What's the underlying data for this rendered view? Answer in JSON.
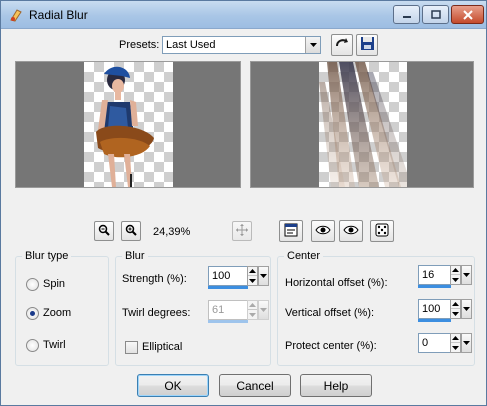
{
  "window": {
    "title": "Radial Blur"
  },
  "presets": {
    "label": "Presets:",
    "value": "Last Used"
  },
  "zoom": {
    "level": "24,39%"
  },
  "blur_type": {
    "title": "Blur type",
    "options": [
      {
        "label": "Spin",
        "selected": false
      },
      {
        "label": "Zoom",
        "selected": true
      },
      {
        "label": "Twirl",
        "selected": false
      }
    ]
  },
  "blur": {
    "title": "Blur",
    "strength_label": "Strength (%):",
    "strength_value": "100",
    "strength_fraction": 1.0,
    "twirl_label": "Twirl degrees:",
    "twirl_value": "61",
    "elliptical_label": "Elliptical",
    "elliptical_checked": false
  },
  "center": {
    "title": "Center",
    "h_offset_label": "Horizontal offset (%):",
    "h_offset_value": "16",
    "v_offset_label": "Vertical offset (%):",
    "v_offset_value": "100",
    "protect_label": "Protect center (%):",
    "protect_value": "0"
  },
  "buttons": {
    "ok": "OK",
    "cancel": "Cancel",
    "help": "Help"
  },
  "colors": {
    "accent": "#3c8ee0",
    "preview_bg": "#767676",
    "title_bar": "#a9c6e6",
    "close_button": "#c44a2c"
  }
}
